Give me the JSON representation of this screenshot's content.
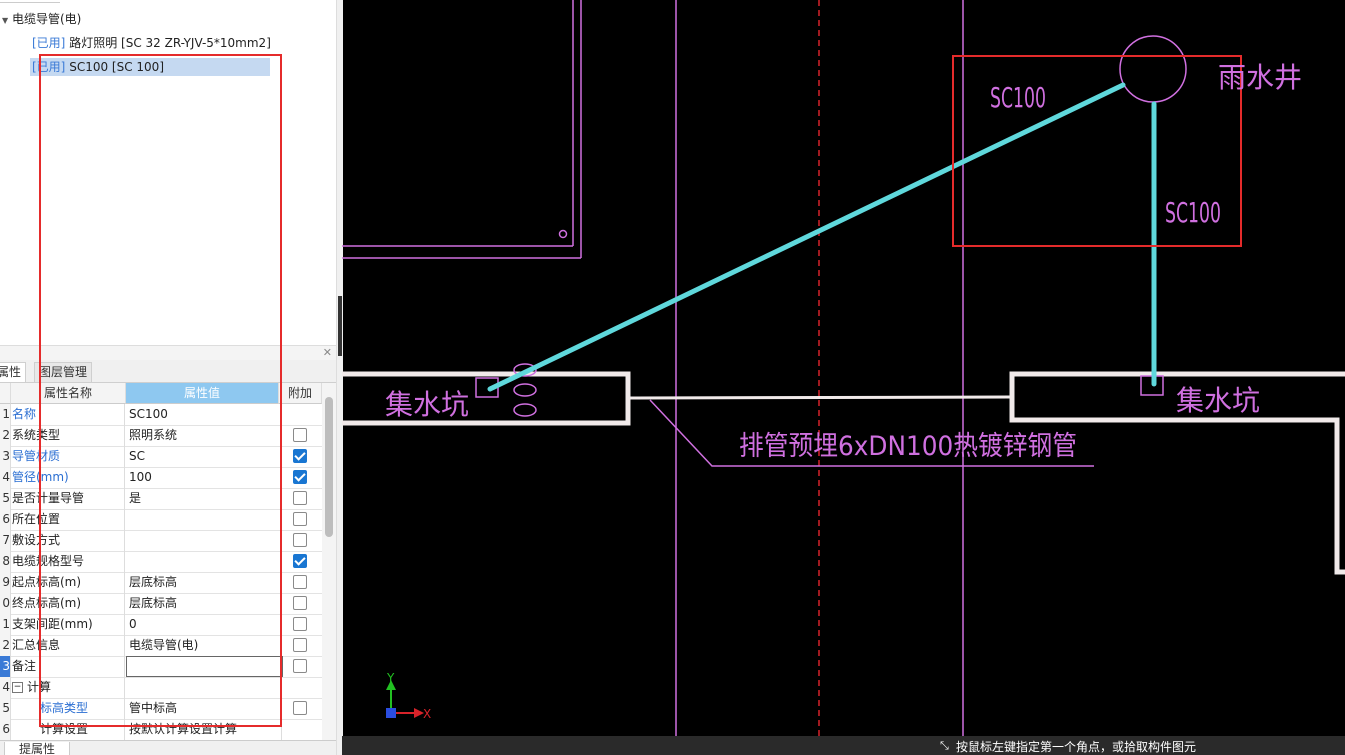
{
  "tree": {
    "group_label": "电缆导管(电)",
    "items": [
      {
        "tag": "[已用]",
        "label": "路灯照明 [SC 32 ZR-YJV-5*10mm2]"
      },
      {
        "tag": "[已用]",
        "label": "SC100 [SC 100]"
      }
    ]
  },
  "tabs": {
    "properties": "属性",
    "layers": "图层管理"
  },
  "grid": {
    "headers": {
      "name": "属性名称",
      "value": "属性值",
      "extra": "附加"
    },
    "rows": [
      {
        "num": "1",
        "name": "名称",
        "value": "SC100",
        "blue": true,
        "check": null
      },
      {
        "num": "2",
        "name": "系统类型",
        "value": "照明系统",
        "blue": false,
        "check": false
      },
      {
        "num": "3",
        "name": "导管材质",
        "value": "SC",
        "blue": true,
        "check": true
      },
      {
        "num": "4",
        "name": "管径(mm)",
        "value": "100",
        "blue": true,
        "check": true
      },
      {
        "num": "5",
        "name": "是否计量导管",
        "value": "是",
        "blue": false,
        "check": false
      },
      {
        "num": "6",
        "name": "所在位置",
        "value": "",
        "blue": false,
        "check": false
      },
      {
        "num": "7",
        "name": "敷设方式",
        "value": "",
        "blue": false,
        "check": false
      },
      {
        "num": "8",
        "name": "电缆规格型号",
        "value": "",
        "blue": false,
        "check": true
      },
      {
        "num": "9",
        "name": "起点标高(m)",
        "value": "层底标高",
        "blue": false,
        "check": false
      },
      {
        "num": "0",
        "name": "终点标高(m)",
        "value": "层底标高",
        "blue": false,
        "check": false
      },
      {
        "num": "1",
        "name": "支架间距(mm)",
        "value": "0",
        "blue": false,
        "check": false
      },
      {
        "num": "2",
        "name": "汇总信息",
        "value": "电缆导管(电)",
        "blue": false,
        "check": false
      },
      {
        "num": "3",
        "name": "备注",
        "value": "",
        "blue": false,
        "check": false
      },
      {
        "num": "4",
        "name": "计算",
        "value": "",
        "blue": false,
        "check": null
      },
      {
        "num": "5",
        "name": "标高类型",
        "value": "管中标高",
        "blue": true,
        "check": false
      },
      {
        "num": "6",
        "name": "计算设置",
        "value": "按默认计算设置计算",
        "blue": false,
        "check": null
      }
    ]
  },
  "bottom_tab": "提属性",
  "drawing": {
    "labels": {
      "sc100_a": "SC100",
      "sc100_b": "SC100",
      "rain_well": "雨水井",
      "sump_left": "集水坑",
      "sump_right": "集水坑",
      "pipe_note": "排管预埋6xDN100热镀锌钢管"
    },
    "axis": {
      "x": "X",
      "y": "Y"
    },
    "colors": {
      "magenta": "#d070e0",
      "pipe": "#5fd8dc",
      "wall": "#f1eaea",
      "red": "#e52b2b",
      "axis_red": "#d8232a"
    }
  },
  "status": {
    "text": "按鼠标左键指定第一个角点，或拾取构件图元"
  }
}
